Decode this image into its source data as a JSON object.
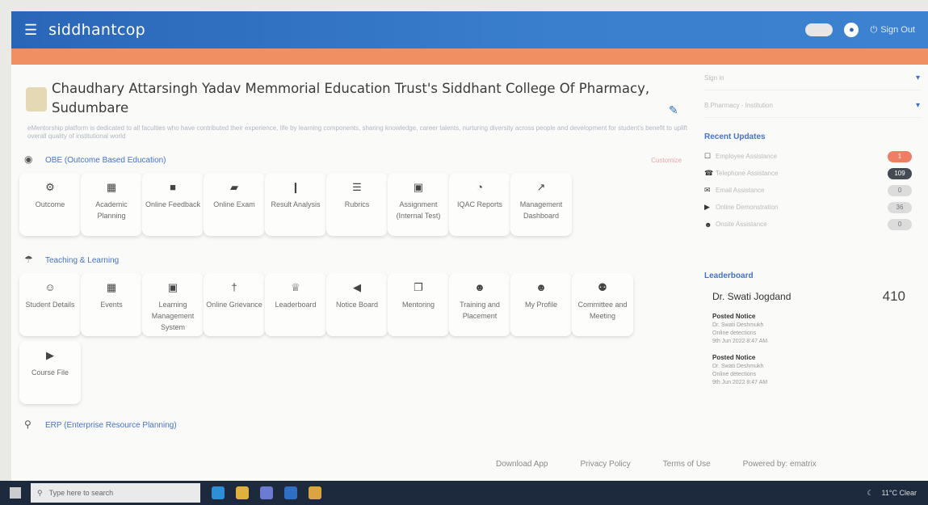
{
  "app": {
    "brand": "siddhantcop",
    "signout": "Sign Out"
  },
  "college": {
    "name": "Chaudhary Attarsingh Yadav Memmorial Education Trust's Siddhant College Of Pharmacy, Sudumbare",
    "tagline": "eMentorship platform is dedicated to all faculties who have contributed their experience, life by learning components, sharing knowledge, career talents, nurturing diversity across people and development for student's benefit to uplift overall quality of institutional world"
  },
  "obe": {
    "title": "OBE (Outcome Based Education)",
    "reset": "Customize",
    "tiles": [
      {
        "icon": "⚙",
        "label": "Outcome"
      },
      {
        "icon": "▦",
        "label": "Academic Planning"
      },
      {
        "icon": "■",
        "label": "Online Feedback"
      },
      {
        "icon": "▰",
        "label": "Online Exam"
      },
      {
        "icon": "❙",
        "label": "Result Analysis"
      },
      {
        "icon": "☰",
        "label": "Rubrics"
      },
      {
        "icon": "▣",
        "label": "Assignment (Internal Test)"
      },
      {
        "icon": "◔",
        "label": "IQAC Reports"
      },
      {
        "icon": "↗",
        "label": "Management Dashboard"
      }
    ]
  },
  "teaching": {
    "title": "Teaching & Learning",
    "tiles": [
      {
        "icon": "☺",
        "label": "Student Details"
      },
      {
        "icon": "▦",
        "label": "Events"
      },
      {
        "icon": "▣",
        "label": "Learning Management System"
      },
      {
        "icon": "†",
        "label": "Online Grievance"
      },
      {
        "icon": "♕",
        "label": "Leaderboard"
      },
      {
        "icon": "◀",
        "label": "Notice Board"
      },
      {
        "icon": "❐",
        "label": "Mentoring"
      },
      {
        "icon": "☻",
        "label": "Training and Placement"
      },
      {
        "icon": "☻",
        "label": "My Profile"
      },
      {
        "icon": "⚉",
        "label": "Committee and Meeting"
      },
      {
        "icon": "▶",
        "label": "Course File"
      }
    ]
  },
  "erp": {
    "title": "ERP (Enterprise Resource Planning)"
  },
  "footer": {
    "download": "Download App",
    "privacy": "Privacy Policy",
    "terms": "Terms of Use",
    "powered": "Powered by: ematrix"
  },
  "side": {
    "select1": "Sign in",
    "select2": "B.Pharmacy - Institution",
    "updates_title": "Recent Updates",
    "updates": [
      {
        "icon": "☐",
        "label": "Employee Assistance",
        "count": "1",
        "color": "#f07e62"
      },
      {
        "icon": "☎",
        "label": "Telephone Assistance",
        "count": "109",
        "color": "#444a52"
      },
      {
        "icon": "✉",
        "label": "Email Assistance",
        "count": "0",
        "color": "#dcdcdc"
      },
      {
        "icon": "▶",
        "label": "Online Demonstration",
        "count": "36",
        "color": "#dcdcdc"
      },
      {
        "icon": "☻",
        "label": "Onsite Assistance",
        "count": "0",
        "color": "#dcdcdc"
      }
    ],
    "leaderboard_title": "Leaderboard",
    "leader_name": "Dr. Swati Jogdand",
    "leader_score": "410",
    "notices": [
      {
        "title": "Posted Notice",
        "by": "Dr. Swati Deshmukh",
        "sub": "Online detections",
        "time": "9th Jun 2022 8:47 AM"
      },
      {
        "title": "Posted Notice",
        "by": "Dr. Swati Deshmukh",
        "sub": "Online detections",
        "time": "9th Jun 2022 8:47 AM"
      }
    ]
  },
  "taskbar": {
    "search": "Type here to search",
    "weather": "11°C Clear"
  }
}
